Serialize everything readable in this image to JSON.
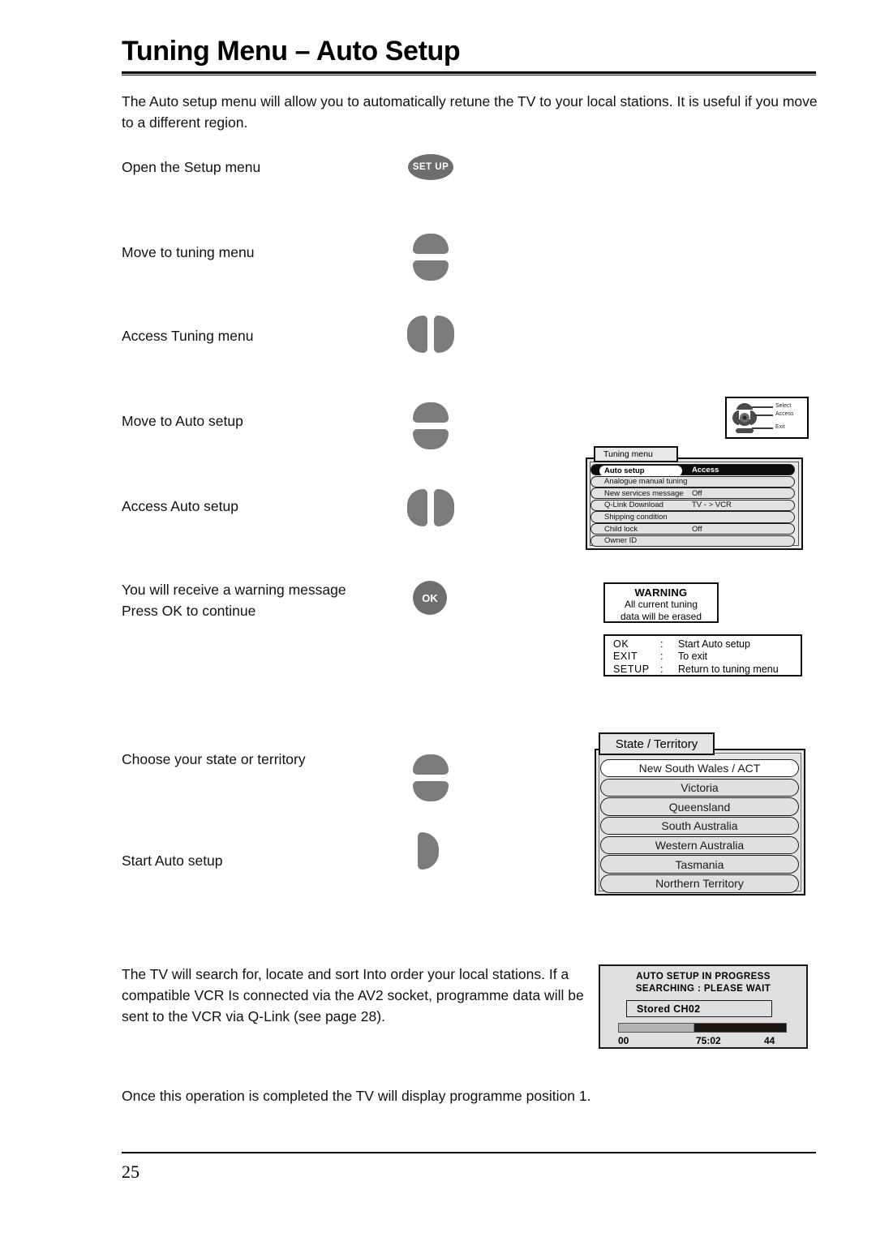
{
  "page": {
    "title": "Tuning Menu – Auto Setup",
    "number": "25",
    "intro": "The Auto setup menu will allow you to automatically retune the TV to your local stations. It is useful if you move to a different region.",
    "search_note": "The TV will search for, locate and sort Into order your local stations. If a compatible VCR Is connected via the AV2 socket, programme data will be sent to the VCR via Q-Link (see page 28).",
    "finish_note": "Once this operation is completed the TV will display programme position 1."
  },
  "steps": [
    {
      "label": "Open the Setup menu",
      "key": "setup",
      "key_label": "SET UP"
    },
    {
      "label": "Move to tuning menu",
      "key": "updown",
      "key_label": ""
    },
    {
      "label": "Access Tuning menu",
      "key": "leftright",
      "key_label": ""
    },
    {
      "label": "Move to Auto setup",
      "key": "updown",
      "key_label": ""
    },
    {
      "label": "Access Auto setup",
      "key": "leftright",
      "key_label": ""
    },
    {
      "label": "You will receive a warning message\nPress OK to continue",
      "key": "ok",
      "key_label": "OK"
    },
    {
      "label": "Choose your state or territory",
      "key": "updown",
      "key_label": ""
    },
    {
      "label": "Start Auto setup",
      "key": "right",
      "key_label": ""
    }
  ],
  "nav_legend": {
    "select": "Select",
    "access": "Access",
    "exit": "Exit"
  },
  "tuning_menu": {
    "title": "Tuning menu",
    "rows": [
      {
        "label": "Auto setup",
        "value": "Access",
        "highlight": true
      },
      {
        "label": "Analogue manual tuning",
        "value": "",
        "highlight": false
      },
      {
        "label": "New services message",
        "value": "Off",
        "highlight": false
      },
      {
        "label": "Q-Link Download",
        "value": "TV - > VCR",
        "highlight": false
      },
      {
        "label": "Shipping condition",
        "value": "",
        "highlight": false
      },
      {
        "label": "Child lock",
        "value": "Off",
        "highlight": false
      },
      {
        "label": "Owner ID",
        "value": "",
        "highlight": false
      }
    ]
  },
  "warning": {
    "title": "WARNING",
    "body": "All current tuning\ndata will be erased",
    "keys": [
      {
        "key": "OK",
        "sep": ":",
        "action": "Start Auto setup"
      },
      {
        "key": "EXIT",
        "sep": ":",
        "action": "To exit"
      },
      {
        "key": "SETUP",
        "sep": ":",
        "action": "Return to tuning menu"
      }
    ]
  },
  "state_territory": {
    "title": "State / Territory",
    "items": [
      {
        "label": "New South Wales / ACT",
        "selected": true
      },
      {
        "label": "Victoria",
        "selected": false
      },
      {
        "label": "Queensland",
        "selected": false
      },
      {
        "label": "South Australia",
        "selected": false
      },
      {
        "label": "Western Australia",
        "selected": false
      },
      {
        "label": "Tasmania",
        "selected": false
      },
      {
        "label": "Northern Territory",
        "selected": false
      }
    ]
  },
  "progress": {
    "heading": "AUTO SETUP IN PROGRESS\nSEARCHING  :   PLEASE WAIT",
    "stored_label": "Stored  CH02",
    "bar_percent": 45,
    "left_value": "00",
    "mid_value": "75:02",
    "right_value": "44"
  }
}
